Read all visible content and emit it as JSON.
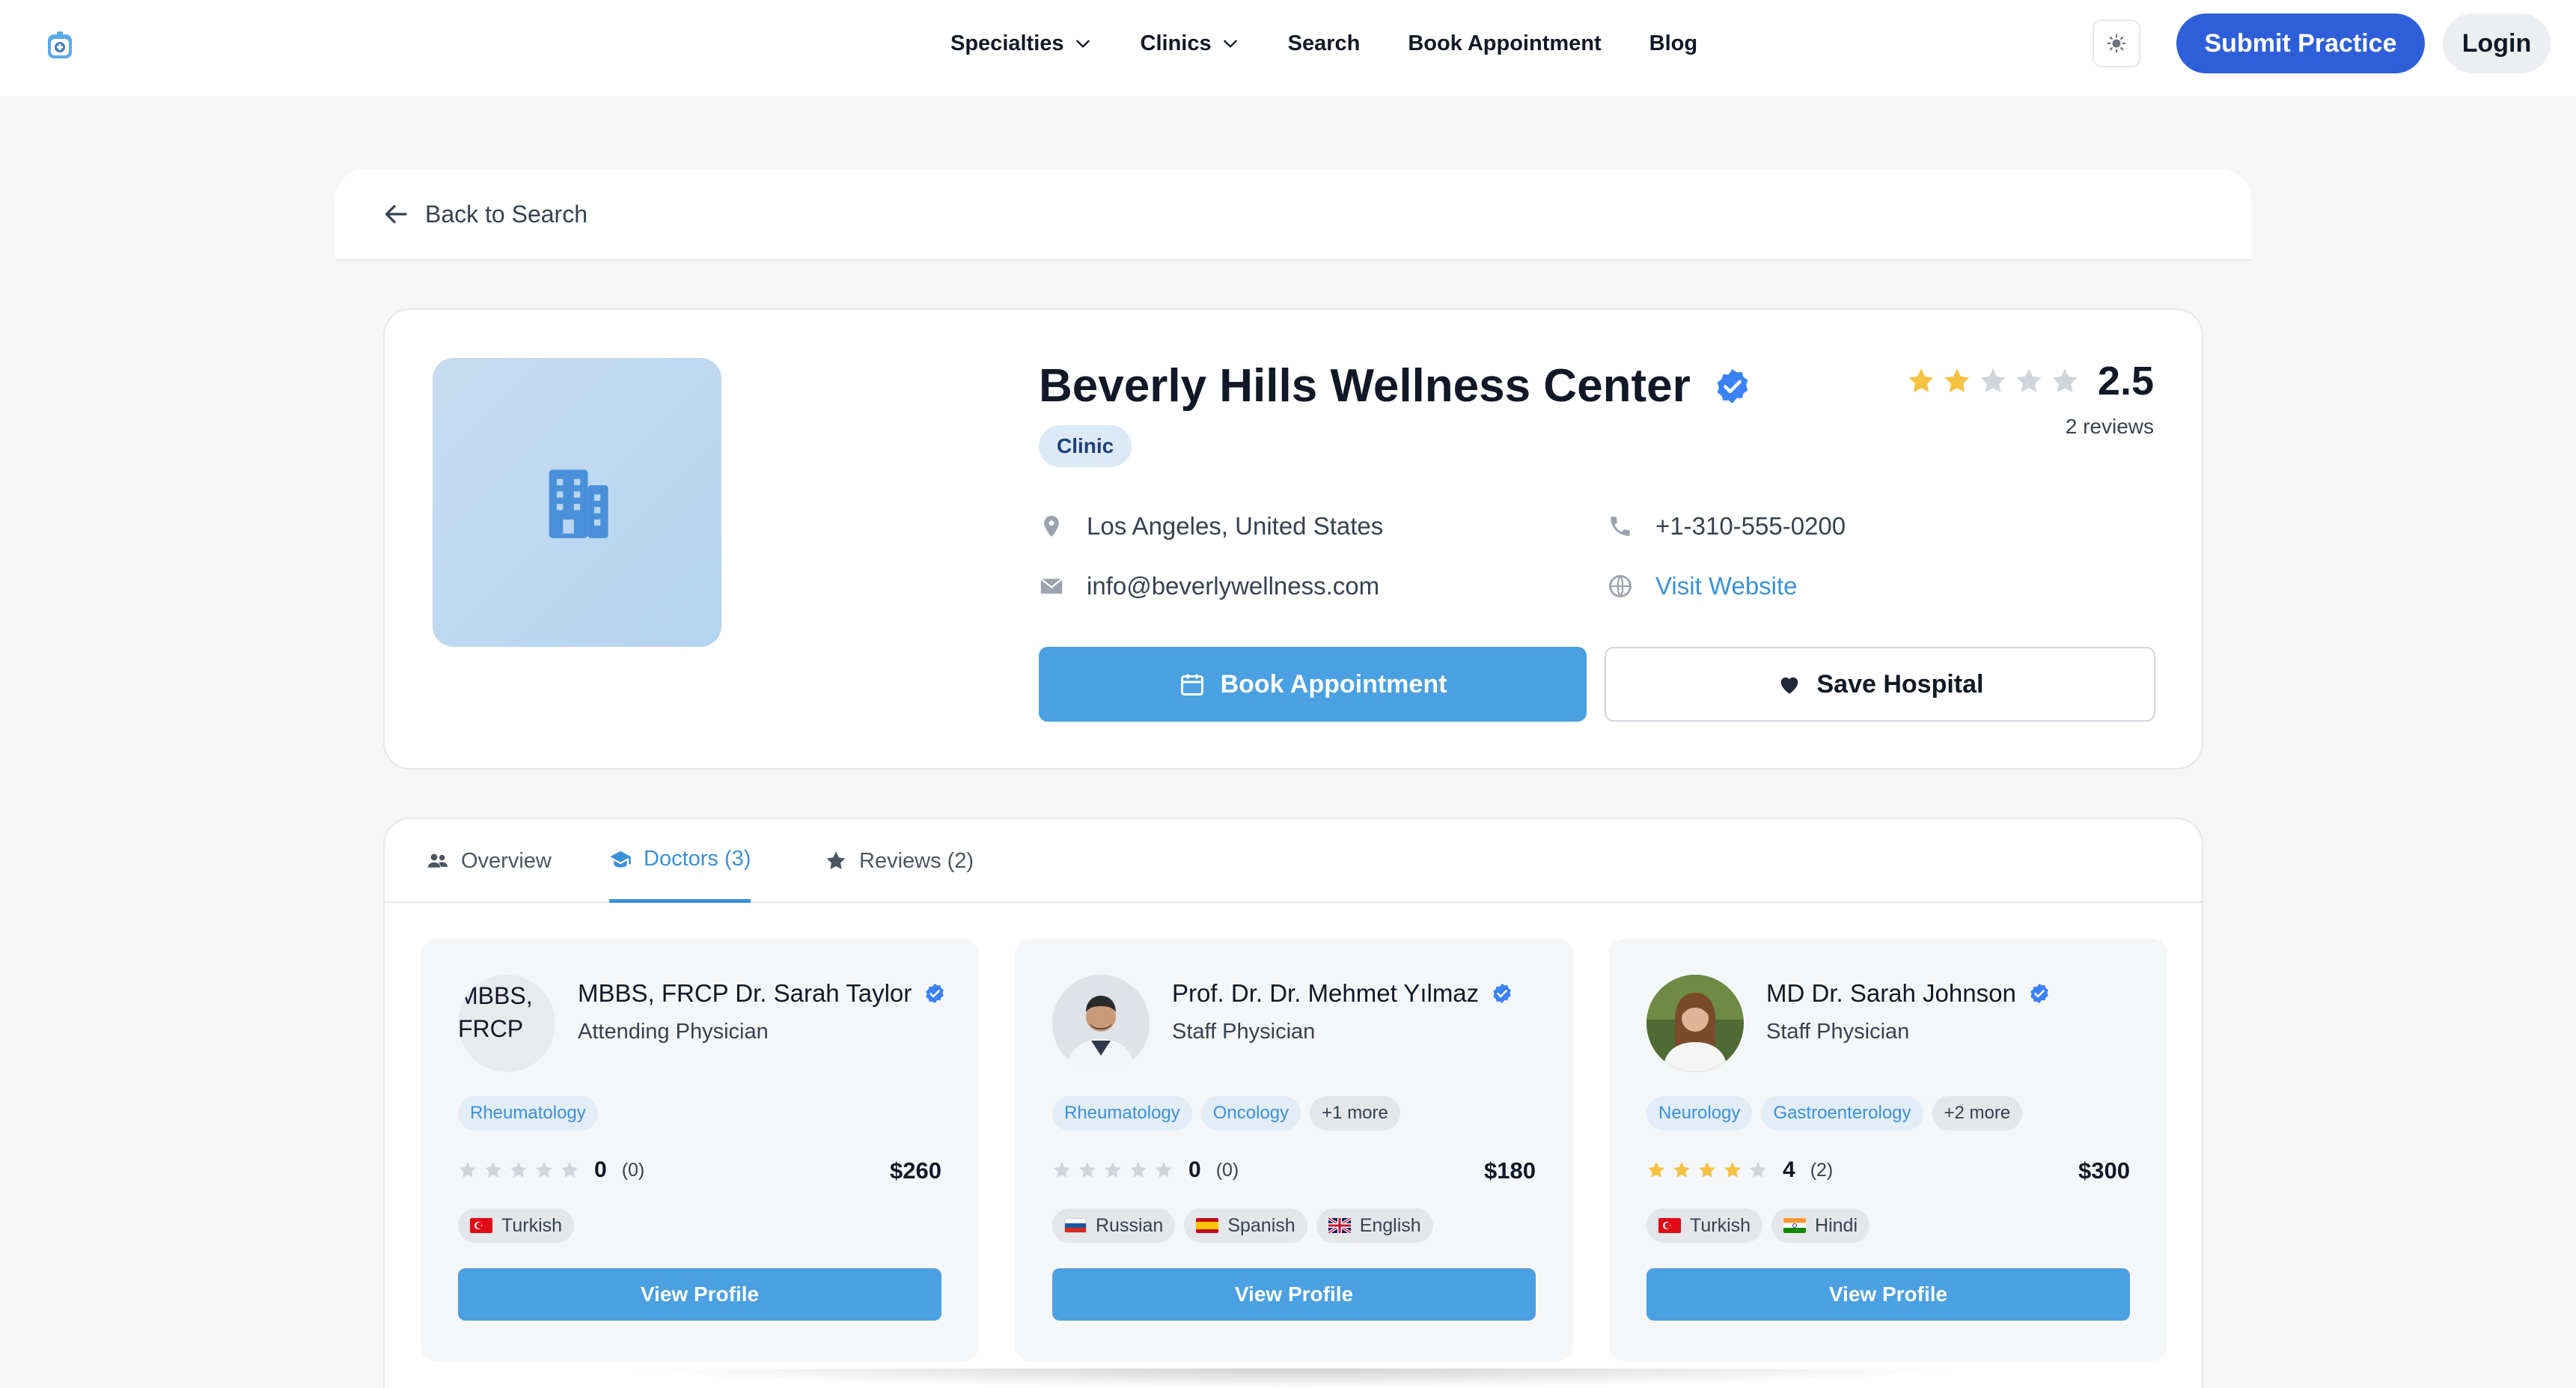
{
  "nav": {
    "logo_icon": "hospital-logo-icon",
    "links": [
      {
        "label": "Specialties",
        "dropdown": true
      },
      {
        "label": "Clinics",
        "dropdown": true
      },
      {
        "label": "Search",
        "dropdown": false
      },
      {
        "label": "Book Appointment",
        "dropdown": false
      },
      {
        "label": "Blog",
        "dropdown": false
      }
    ],
    "theme_icon": "sun-icon",
    "submit_label": "Submit Practice",
    "login_label": "Login"
  },
  "back": {
    "label": "Back to Search"
  },
  "clinic": {
    "name": "Beverly Hills Wellness Center",
    "type": "Clinic",
    "rating": "2.5",
    "rating_stars": 2.5,
    "reviews_label": "2 reviews",
    "location": "Los Angeles, United States",
    "phone": "+1-310-555-0200",
    "email": "info@beverlywellness.com",
    "website_label": "Visit Website",
    "book_label": "Book Appointment",
    "save_label": "Save Hospital"
  },
  "tabs": [
    {
      "label": "Overview",
      "icon": "users-icon",
      "active": false
    },
    {
      "label": "Doctors (3)",
      "icon": "graduation-cap-icon",
      "active": true
    },
    {
      "label": "Reviews (2)",
      "icon": "star-icon",
      "active": false
    }
  ],
  "doctors": [
    {
      "name": "MBBS, FRCP Dr. Sarah Taylor",
      "role": "Attending Physician",
      "avatar_alt": "MBBS, FRCP",
      "specialties": [
        "Rheumatology"
      ],
      "more": "",
      "rating": "0",
      "rating_stars": 0,
      "reviews": "(0)",
      "price": "$260",
      "languages": [
        {
          "label": "Turkish",
          "flag": "tr"
        }
      ],
      "button": "View Profile"
    },
    {
      "name": "Prof. Dr. Dr. Mehmet Yılmaz",
      "role": "Staff Physician",
      "avatar_alt": "",
      "specialties": [
        "Rheumatology",
        "Oncology"
      ],
      "more": "+1 more",
      "rating": "0",
      "rating_stars": 0,
      "reviews": "(0)",
      "price": "$180",
      "languages": [
        {
          "label": "Russian",
          "flag": "ru"
        },
        {
          "label": "Spanish",
          "flag": "es"
        },
        {
          "label": "English",
          "flag": "gb"
        }
      ],
      "button": "View Profile"
    },
    {
      "name": "MD Dr. Sarah Johnson",
      "role": "Staff Physician",
      "avatar_alt": "",
      "specialties": [
        "Neurology",
        "Gastroenterology"
      ],
      "more": "+2 more",
      "rating": "4",
      "rating_stars": 4,
      "reviews": "(2)",
      "price": "$300",
      "languages": [
        {
          "label": "Turkish",
          "flag": "tr"
        },
        {
          "label": "Hindi",
          "flag": "in"
        }
      ],
      "button": "View Profile"
    }
  ],
  "colors": {
    "primary": "#4aa0e0",
    "submit": "#2f5fd8",
    "star_filled": "#f5c242",
    "star_empty": "#d1d5db",
    "verified": "#3b82f6"
  }
}
